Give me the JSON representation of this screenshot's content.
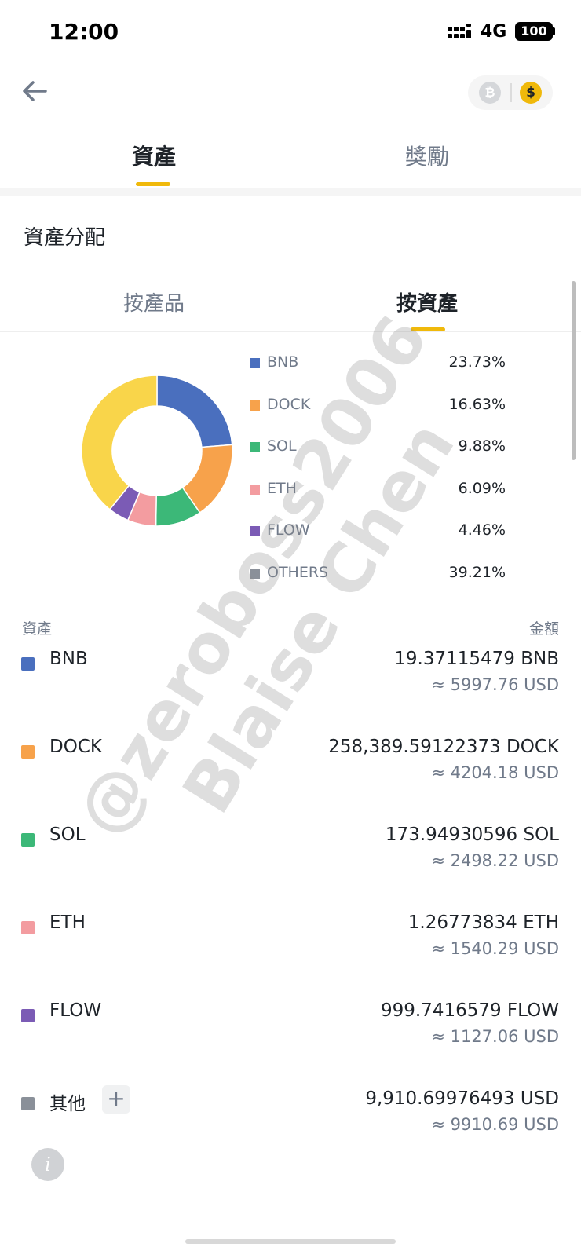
{
  "status_bar": {
    "time": "12:00",
    "network": "4G",
    "battery": "100"
  },
  "header": {
    "currency_options": [
      "BTC",
      "USD"
    ],
    "selected_currency": "USD"
  },
  "main_tabs": [
    {
      "label": "資產",
      "active": true
    },
    {
      "label": "獎勵",
      "active": false
    }
  ],
  "section_title": "資產分配",
  "sub_tabs": [
    {
      "label": "按產品",
      "active": false
    },
    {
      "label": "按資產",
      "active": true
    }
  ],
  "chart_data": {
    "type": "pie",
    "categories": [
      "BNB",
      "DOCK",
      "SOL",
      "ETH",
      "FLOW",
      "OTHERS"
    ],
    "values": [
      23.73,
      16.63,
      9.88,
      6.09,
      4.46,
      39.21
    ],
    "value_labels": [
      "23.73%",
      "16.63%",
      "9.88%",
      "6.09%",
      "4.46%",
      "39.21%"
    ],
    "colors": [
      "#4a6fbe",
      "#f7a24b",
      "#3cb878",
      "#f39ca0",
      "#7b5bb5",
      "#f9d54a"
    ],
    "legend_swatch_colors": [
      "#4a6fbe",
      "#f7a24b",
      "#3cb878",
      "#f39ca0",
      "#7b5bb5",
      "#8a9099"
    ],
    "donut": true,
    "legend": "right"
  },
  "asset_list": {
    "header_asset": "資產",
    "header_amount": "金額",
    "items": [
      {
        "name": "BNB",
        "amount": "19.37115479 BNB",
        "usd": "≈ 5997.76 USD",
        "color": "#4a6fbe"
      },
      {
        "name": "DOCK",
        "amount": "258,389.59122373 DOCK",
        "usd": "≈ 4204.18 USD",
        "color": "#f7a24b"
      },
      {
        "name": "SOL",
        "amount": "173.94930596 SOL",
        "usd": "≈ 2498.22 USD",
        "color": "#3cb878"
      },
      {
        "name": "ETH",
        "amount": "1.26773834 ETH",
        "usd": "≈ 1540.29 USD",
        "color": "#f39ca0"
      },
      {
        "name": "FLOW",
        "amount": "999.7416579 FLOW",
        "usd": "≈ 1127.06 USD",
        "color": "#7b5bb5"
      },
      {
        "name": "其他",
        "amount": "9,910.69976493 USD",
        "usd": "≈ 9910.69 USD",
        "color": "#8a9099",
        "expand_label": "+"
      }
    ]
  },
  "info_label": "i",
  "watermark": {
    "line1": "@zeroboss2006",
    "line2": "Blaise Chen"
  },
  "colors": {
    "accent": "#f0b90b",
    "text_primary": "#1e2329",
    "text_secondary": "#707a8a"
  }
}
